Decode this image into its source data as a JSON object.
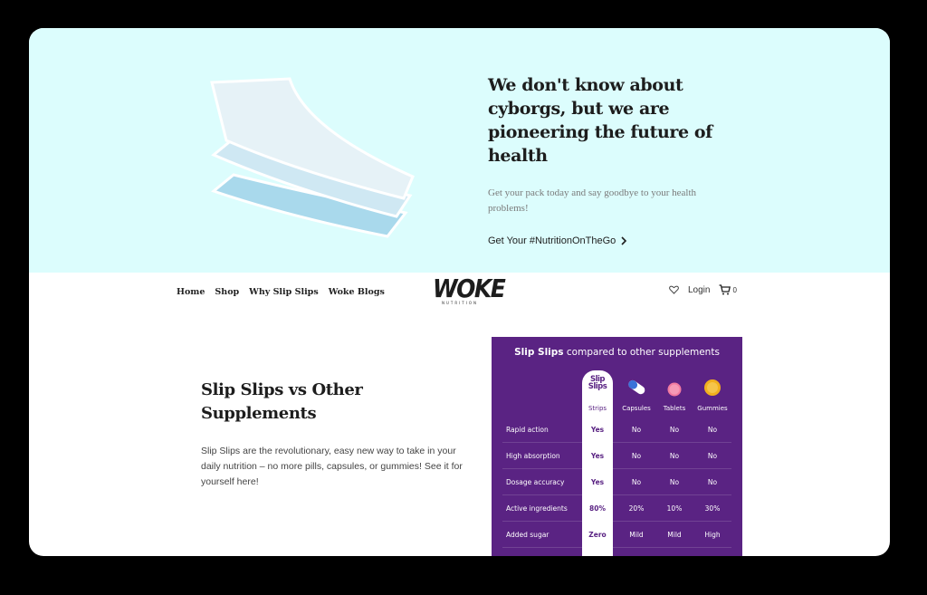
{
  "hero": {
    "title": "We don't know about cyborgs, but we are pioneering the future of health",
    "subtitle": "Get your pack today and say goodbye to your health problems!",
    "cta_label": "Get Your #NutritionOnTheGo",
    "bg_color": "#dcfdfd"
  },
  "nav": {
    "links": [
      "Home",
      "Shop",
      "Why Slip Slips",
      "Woke Blogs"
    ],
    "logo_main": "WOKE",
    "logo_sub": "NUTRITION",
    "login_label": "Login",
    "cart_count": "0",
    "wishlist_icon": "heart-icon",
    "cart_icon": "cart-icon"
  },
  "compare": {
    "heading": "Slip Slips vs Other Supplements",
    "body": "Slip Slips are the revolutionary, easy new way to take in your daily nutrition – no more pills, capsules, or gummies! See it for yourself here!",
    "table": {
      "title_bold": "Slip Slips",
      "title_rest": "compared to other supplements",
      "accent_color": "#5a2383",
      "strips_logo": [
        "Slip",
        "Slips"
      ],
      "columns": [
        "Strips",
        "Capsules",
        "Tablets",
        "Gummies"
      ],
      "column_icons": [
        "slip-slips-logo",
        "capsule-icon",
        "tablet-icon",
        "gummy-icon"
      ],
      "rows": [
        {
          "label": "Rapid action",
          "values": [
            "Yes",
            "No",
            "No",
            "No"
          ]
        },
        {
          "label": "High absorption",
          "values": [
            "Yes",
            "No",
            "No",
            "No"
          ]
        },
        {
          "label": "Dosage accuracy",
          "values": [
            "Yes",
            "No",
            "No",
            "No"
          ]
        },
        {
          "label": "Active ingredients",
          "values": [
            "80%",
            "20%",
            "10%",
            "30%"
          ]
        },
        {
          "label": "Added sugar",
          "values": [
            "Zero",
            "Mild",
            "Mild",
            "High"
          ]
        }
      ]
    }
  }
}
